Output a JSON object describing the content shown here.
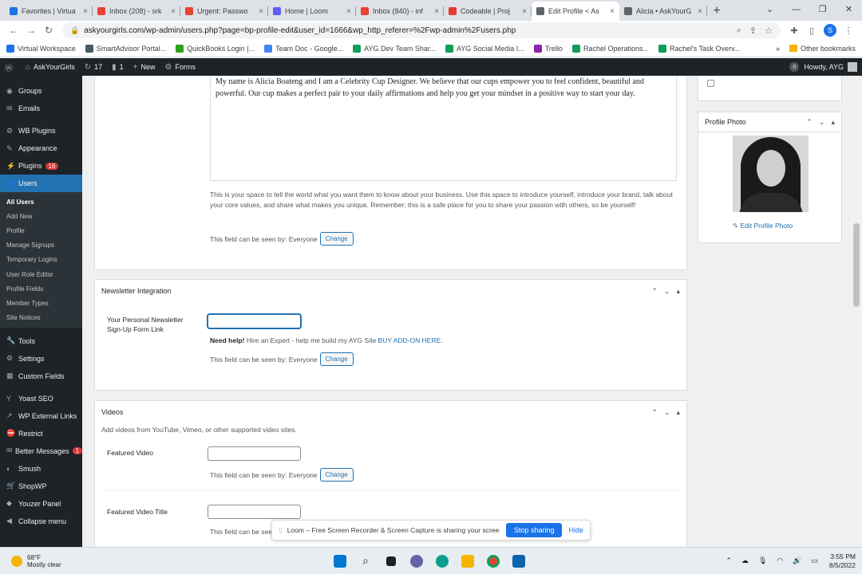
{
  "browser": {
    "tabs": [
      {
        "title": "Favorites | Virtua",
        "color": "#1a73e8",
        "active": false
      },
      {
        "title": "Inbox (208) - srk",
        "color": "#ea4335",
        "active": false
      },
      {
        "title": "Urgent: Passwo",
        "color": "#ea4335",
        "active": false
      },
      {
        "title": "Home | Loom",
        "color": "#625df5",
        "active": false
      },
      {
        "title": "Inbox (840) - inf",
        "color": "#ea4335",
        "active": false
      },
      {
        "title": "Codeable | Proj",
        "color": "#e53935",
        "active": false
      },
      {
        "title": "Edit Profile < As",
        "color": "#5f6368",
        "active": true
      },
      {
        "title": "Alicia • AskYourG",
        "color": "#5f6368",
        "active": false
      }
    ],
    "url": "askyourgirls.com/wp-admin/users.php?page=bp-profile-edit&user_id=1666&wp_http_referer=%2Fwp-admin%2Fusers.php",
    "profile_initial": "S",
    "bookmarks": [
      {
        "label": "Virtual Workspace",
        "color": "#1a73e8"
      },
      {
        "label": "SmartAdvisor Portal...",
        "color": "#455a64"
      },
      {
        "label": "QuickBooks Login |...",
        "color": "#2ca01c"
      },
      {
        "label": "Team Doc - Google...",
        "color": "#4285f4"
      },
      {
        "label": "AYG Dev Team Shar...",
        "color": "#0f9d58"
      },
      {
        "label": "AYG Social Media I...",
        "color": "#0f9d58"
      },
      {
        "label": "Trello",
        "color": "#8e24aa"
      },
      {
        "label": "Rachel Operations...",
        "color": "#0f9d58"
      },
      {
        "label": "Rachel's Task Overv...",
        "color": "#0f9d58"
      }
    ],
    "more_bookmarks": "»",
    "other_bookmarks": "Other bookmarks"
  },
  "adminbar": {
    "site_name": "AskYourGirls",
    "updates": "17",
    "comments": "1",
    "new_label": "New",
    "forms_label": "Forms",
    "notifications": "0",
    "howdy": "Howdy, AYG"
  },
  "sidebar": {
    "top_items": [
      {
        "label": "Groups",
        "icon": "◉"
      },
      {
        "label": "Emails",
        "icon": "✉"
      }
    ],
    "items2": [
      {
        "label": "WB Plugins",
        "icon": "⚙"
      },
      {
        "label": "Appearance",
        "icon": "✎"
      },
      {
        "label": "Plugins",
        "icon": "⚡",
        "badge": "16"
      },
      {
        "label": "Users",
        "icon": "👤",
        "current": true
      }
    ],
    "submenu": [
      {
        "label": "All Users",
        "current": true
      },
      {
        "label": "Add New"
      },
      {
        "label": "Profile"
      },
      {
        "label": "Manage Signups"
      },
      {
        "label": "Temporary Logins"
      },
      {
        "label": "User Role Editor"
      },
      {
        "label": "Profile Fields"
      },
      {
        "label": "Member Types"
      },
      {
        "label": "Site Notices"
      }
    ],
    "items3": [
      {
        "label": "Tools",
        "icon": "🔧"
      },
      {
        "label": "Settings",
        "icon": "⚙"
      },
      {
        "label": "Custom Fields",
        "icon": "▦"
      }
    ],
    "items4": [
      {
        "label": "Yoast SEO",
        "icon": "Y"
      },
      {
        "label": "WP External Links",
        "icon": "↗"
      },
      {
        "label": "Restrict",
        "icon": "⛔"
      },
      {
        "label": "Better Messages",
        "icon": "✉",
        "badge": "1"
      },
      {
        "label": "Smush",
        "icon": "◐"
      },
      {
        "label": "ShopWP",
        "icon": "🛒"
      },
      {
        "label": "Youzer Panel",
        "icon": "◆"
      },
      {
        "label": "Collapse menu",
        "icon": "◀"
      }
    ]
  },
  "about": {
    "text": "My name is Alicia Boateng and I am a Celebrity Cup Designer. We believe that our cups empower you to feel confident, beautiful and powerful. Our cup makes a perfect pair to your daily affirmations and help you get your mindset in a positive way to start your day.",
    "description": "This is your space to tell the world what you want them to know about your business. Use this space to introduce yourself, introduce your brand, talk about your core values, and share what makes you unique. Remember: this is a safe place for you to share your passion with others, so be yourself!",
    "visibility": "This field can be seen by: Everyone",
    "change_label": "Change"
  },
  "profile_photo": {
    "title": "Profile Photo",
    "edit_label": "Edit Profile Photo"
  },
  "newsletter": {
    "title": "Newsletter Integration",
    "field_label": "Your Personal Newsletter Sign-Up Form Link",
    "value": "",
    "help_prefix": "Need help!",
    "help_text": " Hire an Expert - help me build my AYG Site ",
    "help_link": "BUY ADD-ON HERE",
    "help_suffix": ".",
    "visibility": "This field can be seen by: Everyone",
    "change_label": "Change"
  },
  "videos": {
    "title": "Videos",
    "description": "Add videos from YouTube, Vimeo, or other supported video sites.",
    "featured_video_label": "Featured Video",
    "featured_video_value": "",
    "visibility": "This field can be seen by: Everyone",
    "change_label": "Change",
    "featured_title_label": "Featured Video Title",
    "featured_title_value": "",
    "visibility2_partial": "This field can be see"
  },
  "loom": {
    "message": "Loom – Free Screen Recorder & Screen Capture is sharing your screen.",
    "stop_label": "Stop sharing",
    "hide_label": "Hide"
  },
  "taskbar": {
    "temp": "68°F",
    "weather": "Mostly clear",
    "time": "3:55 PM",
    "date": "8/5/2022"
  }
}
